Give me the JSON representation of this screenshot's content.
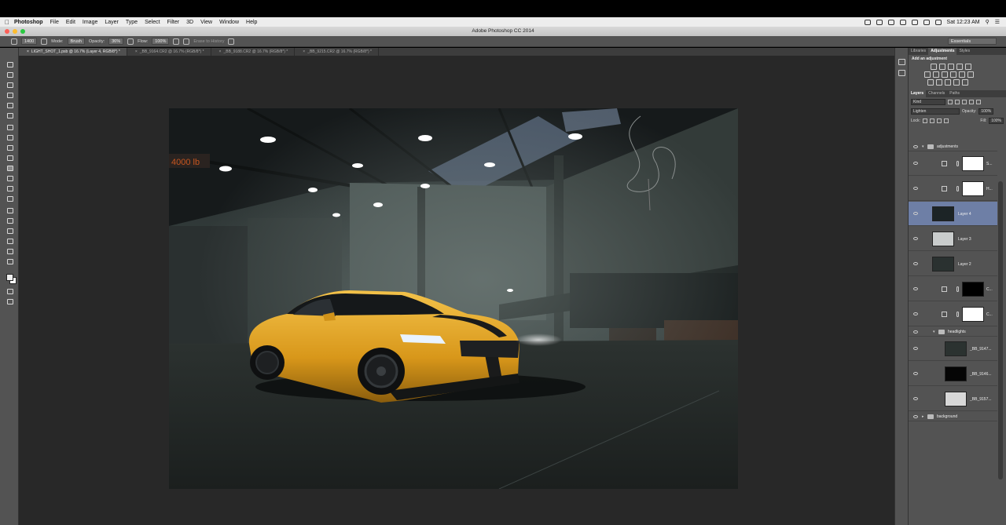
{
  "menubar": {
    "app_name": "Photoshop",
    "items": [
      "File",
      "Edit",
      "Image",
      "Layer",
      "Type",
      "Select",
      "Filter",
      "3D",
      "View",
      "Window",
      "Help"
    ],
    "clock": "Sat 12:23 AM"
  },
  "window": {
    "title": "Adobe Photoshop CC 2014"
  },
  "options": {
    "brush_size": "1400",
    "mode_label": "Mode:",
    "mode_value": "Brush",
    "opacity_label": "Opacity:",
    "opacity_value": "36%",
    "flow_label": "Flow:",
    "flow_value": "100%",
    "erase_history": "Erase to History",
    "workspace": "Essentials"
  },
  "tabs": [
    "LIGHT_SHOT_1.psb @ 16.7% (Layer 4, RGB/8*) *",
    "_BB_9164.CR2 @ 16.7% (RGB/8*) *",
    "_BB_9188.CR2 @ 16.7% (RGB/8*) *",
    "_BB_9215.CR2 @ 16.7% (RGB/8*) *"
  ],
  "panels": {
    "top_tabs": [
      "Libraries",
      "Adjustments",
      "Styles"
    ],
    "add_adjustment": "Add an adjustment",
    "layer_tabs": [
      "Layers",
      "Channels",
      "Paths"
    ],
    "kind": "Kind",
    "blend_mode": "Lighten",
    "opacity_label": "Opacity:",
    "opacity_value": "100%",
    "lock_label": "Lock:",
    "fill_label": "Fill:",
    "fill_value": "100%"
  },
  "layers": {
    "group_adjustments": "adjustments",
    "adj1": "S...",
    "adj2": "H...",
    "layer4": "Layer 4",
    "layer3": "Layer 3",
    "layer2": "Layer 2",
    "c1": "C...",
    "c2": "C...",
    "group_headlights": "headlights",
    "h1": "_BB_9147...",
    "h2": "_BB_9146...",
    "h3": "_BB_9157...",
    "group_background": "background"
  },
  "photo": {
    "sign_text": "4000 lb"
  },
  "colors": {
    "accent_selected_layer": "#6e7fa6",
    "car_body": "#e2a41d"
  }
}
